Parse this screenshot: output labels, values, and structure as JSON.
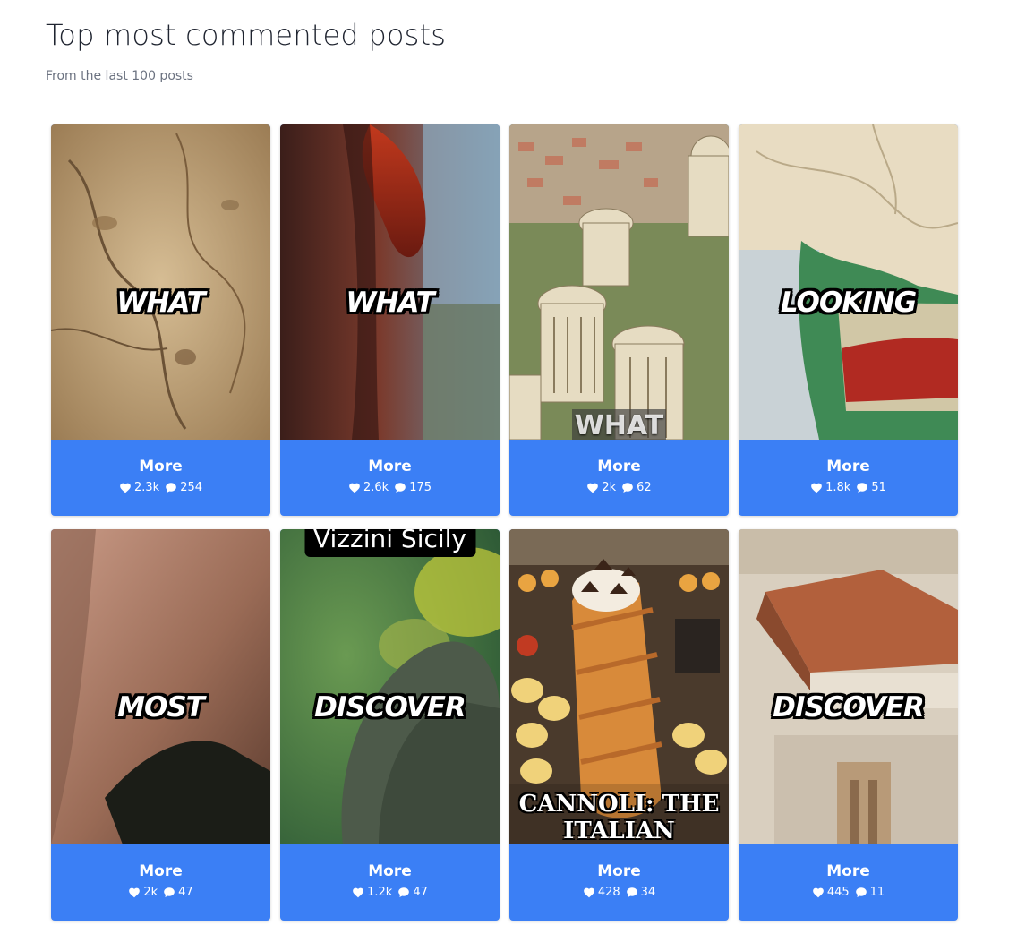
{
  "header": {
    "title": "Top most commented posts",
    "subtitle": "From the last 100 posts"
  },
  "theme": {
    "accent": "#3b7ff5",
    "background": "#ffffff"
  },
  "posts": [
    {
      "caption": "WHAT",
      "more_label": "More",
      "likes": "2.3k",
      "comments": "254",
      "overlay_top": "",
      "overlay_bottom": ""
    },
    {
      "caption": "WHAT",
      "more_label": "More",
      "likes": "2.6k",
      "comments": "175",
      "overlay_top": "",
      "overlay_bottom": ""
    },
    {
      "caption": "",
      "more_label": "More",
      "likes": "2k",
      "comments": "62",
      "overlay_top": "",
      "overlay_bottom": "WHAT"
    },
    {
      "caption": "LOOKING",
      "more_label": "More",
      "likes": "1.8k",
      "comments": "51",
      "overlay_top": "",
      "overlay_bottom": ""
    },
    {
      "caption": "MOST",
      "more_label": "More",
      "likes": "2k",
      "comments": "47",
      "overlay_top": "",
      "overlay_bottom": ""
    },
    {
      "caption": "DISCOVER",
      "more_label": "More",
      "likes": "1.2k",
      "comments": "47",
      "overlay_top": "Vizzini Sicily",
      "overlay_bottom": ""
    },
    {
      "caption": "",
      "more_label": "More",
      "likes": "428",
      "comments": "34",
      "overlay_top": "",
      "overlay_bottom": "CANNOLI: THE ITALIAN"
    },
    {
      "caption": "DISCOVER",
      "more_label": "More",
      "likes": "445",
      "comments": "11",
      "overlay_top": "",
      "overlay_bottom": ""
    }
  ]
}
